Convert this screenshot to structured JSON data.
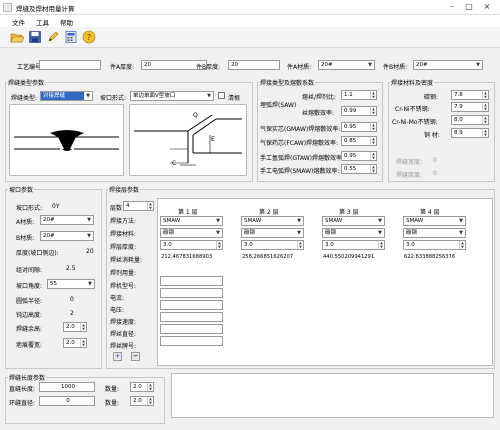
{
  "window": {
    "title": "焊缝及焊材用量计算"
  },
  "menu": {
    "file": "文件",
    "tools": "工具",
    "help": "帮助"
  },
  "top": {
    "proc_label": "工艺编号:",
    "proc_value": "",
    "thickA_label": "件A厚度:",
    "thickA": "20",
    "thickB_label": "件B厚度:",
    "thickB": "20",
    "matA_label": "件A材质:",
    "matA": "20#",
    "matB_label": "件B材质:",
    "matB": "20#"
  },
  "weld_type": {
    "title": "焊缝类型参数",
    "type_label": "焊缝类型:",
    "type_value": "对接焊缝",
    "groove_label": "坡口形式:",
    "groove_value": "单边单面V型坡口",
    "clear_label": "清根",
    "diag_Q": "Q",
    "diag_C": "C",
    "diag_E": "E"
  },
  "method": {
    "title": "焊接类型及熔敷系数",
    "rows": [
      {
        "label": "熔丝/焊剂比:",
        "value": "1.1"
      },
      {
        "label": "埋弧焊(SAW)",
        "value": ""
      },
      {
        "label": "丝熔敷效率:",
        "value": "0.99"
      },
      {
        "label": "气保实芯(GMAW)焊熔敷效率:",
        "value": "0.95"
      },
      {
        "label": "气保药芯(FCAW)焊熔敷效率:",
        "value": "0.85"
      },
      {
        "label": "手工氩弧焊(GTAW)焊熔敷效率:",
        "value": "0.95"
      },
      {
        "label": "手工电弧焊(SMAW)熔敷效率:",
        "value": "0.55"
      }
    ]
  },
  "density": {
    "title": "焊接材料及密度",
    "rows": [
      {
        "label": "碳钢:",
        "value": "7.8"
      },
      {
        "label": "Cr-Ni不锈钢:",
        "value": "7.9"
      },
      {
        "label": "Cr-Ni-Mo不锈钢:",
        "value": "8.0"
      },
      {
        "label": "铜 材:",
        "value": "8.9"
      }
    ],
    "width_label": "焊缝宽度:",
    "width_value": "0",
    "height_label": "焊缝厚度:",
    "height_value": "0"
  },
  "groove": {
    "title": "坡口参数",
    "form_label": "坡口形式:",
    "form_value": "0Y",
    "matA_label": "A材质:",
    "matA": "20#",
    "matB_label": "B材质:",
    "matB": "20#",
    "thick_label": "厚度(坡口侧边):",
    "thick_value": "20",
    "gap_label": "组对间隙:",
    "gap_value": "2.5",
    "angle_label": "坡口角度:",
    "angle_value": "55",
    "radius_label": "圆弧半径:",
    "radius_value": "0",
    "blunt_label": "钝边高度:",
    "blunt_value": "2",
    "reinf_label": "焊缝余高:",
    "reinf_value": "2.0",
    "scar_label": "疤痕覆宽:",
    "scar_value": "2.0"
  },
  "layers": {
    "title": "焊接层参数",
    "count_label": "层数",
    "count_value": "4",
    "row_labels": [
      "焊接方法:",
      "焊接材料:",
      "焊层厚度:",
      "焊丝消耗量:",
      "焊剂用量:",
      "焊机型号:",
      "电流:",
      "电压:",
      "焊接速度:",
      "焊丝直径:",
      "焊丝牌号:"
    ],
    "cols": [
      {
        "header": "第 1 层",
        "method": "SMAW",
        "material": "碳钢",
        "thickness": "3.0",
        "consumption": "212.467831688903"
      },
      {
        "header": "第 2 层",
        "method": "SMAW",
        "material": "碳钢",
        "thickness": "3.0",
        "consumption": "258.266851626207"
      },
      {
        "header": "第 3 层",
        "method": "SMAW",
        "material": "碳钢",
        "thickness": "3.0",
        "consumption": "440.550209941291"
      },
      {
        "header": "第 4 层",
        "method": "SMAW",
        "material": "碳钢",
        "thickness": "3.0",
        "consumption": "622.833888256376"
      }
    ],
    "add": "+",
    "remove": "−"
  },
  "length": {
    "title": "焊缝长度参数",
    "straight_label": "直缝长度:",
    "straight_value": "1000",
    "ring_label": "环缝直径:",
    "ring_value": "0",
    "qty1_label": "数量:",
    "qty1_value": "2.0",
    "qty2_label": "数量:",
    "qty2_value": "2.0"
  },
  "colors": {
    "accent": "#316ac5",
    "frame": "#c8c8c8"
  }
}
